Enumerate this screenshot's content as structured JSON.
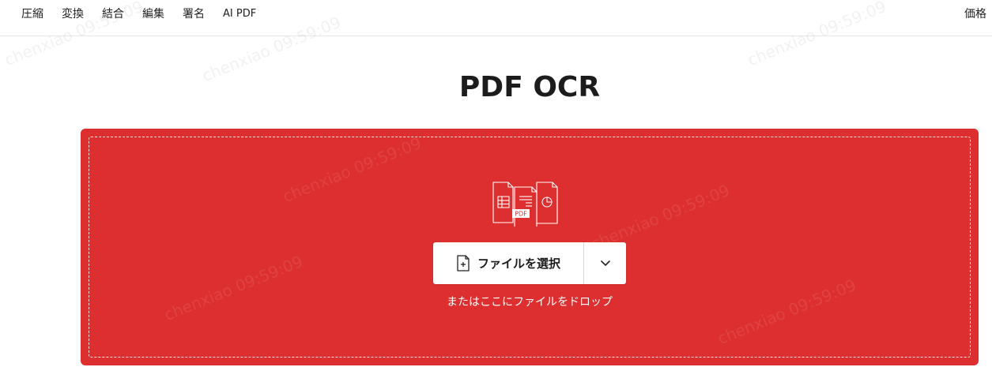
{
  "nav": {
    "items": [
      {
        "label": "圧縮"
      },
      {
        "label": "変換"
      },
      {
        "label": "結合"
      },
      {
        "label": "編集"
      },
      {
        "label": "署名"
      },
      {
        "label": "AI PDF"
      }
    ],
    "pricing_label": "価格"
  },
  "page": {
    "title": "PDF OCR"
  },
  "dropzone": {
    "illustration_badge": "PDF",
    "select_button_label": "ファイルを選択",
    "drop_hint": "またはここにファイルをドロップ"
  },
  "watermark": {
    "text": "chenxiao 09:59:09"
  },
  "colors": {
    "dropzone_background": "#dd2f2f",
    "button_background": "#ffffff",
    "text_dark": "#1c1c1c"
  }
}
